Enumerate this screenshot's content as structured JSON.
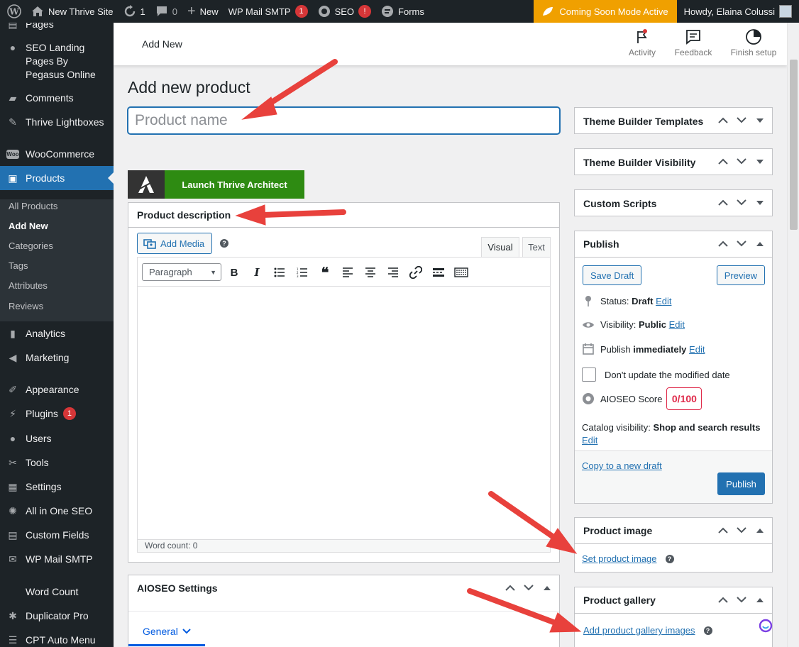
{
  "adminbar": {
    "site_name": "New Thrive Site",
    "updates_count": "1",
    "comments_count": "0",
    "new_label": "New",
    "wpmail_label": "WP Mail SMTP",
    "wpmail_badge": "1",
    "seo_label": "SEO",
    "seo_badge": "!",
    "forms_label": "Forms",
    "coming_soon": "Coming Soon Mode Active",
    "howdy": "Howdy, Elaina Colussi"
  },
  "sidebar": {
    "pages": "Pages",
    "seo_landing": "SEO Landing Pages By Pegasus Online",
    "comments": "Comments",
    "thrive_lightboxes": "Thrive Lightboxes",
    "woocommerce": "WooCommerce",
    "products": "Products",
    "sub": {
      "all_products": "All Products",
      "add_new": "Add New",
      "categories": "Categories",
      "tags": "Tags",
      "attributes": "Attributes",
      "reviews": "Reviews"
    },
    "analytics": "Analytics",
    "marketing": "Marketing",
    "appearance": "Appearance",
    "plugins": "Plugins",
    "plugins_badge": "1",
    "users": "Users",
    "tools": "Tools",
    "settings": "Settings",
    "all_in_one_seo": "All in One SEO",
    "custom_fields": "Custom Fields",
    "wp_mail_smtp": "WP Mail SMTP",
    "word_count": "Word Count",
    "duplicator_pro": "Duplicator Pro",
    "cpt_auto_menu": "CPT Auto Menu"
  },
  "header": {
    "title": "Add New",
    "activity": "Activity",
    "feedback": "Feedback",
    "finish_setup": "Finish setup"
  },
  "main": {
    "page_title": "Add new product",
    "product_name_placeholder": "Product name",
    "launch_thrive": "Launch Thrive Architect",
    "description": {
      "title": "Product description",
      "add_media": "Add Media",
      "tab_visual": "Visual",
      "tab_text": "Text",
      "paragraph": "Paragraph",
      "word_count": "Word count: 0"
    },
    "aioseo": {
      "title": "AIOSEO Settings",
      "tab_general": "General"
    }
  },
  "right": {
    "theme_builder_templates": "Theme Builder Templates",
    "theme_builder_visibility": "Theme Builder Visibility",
    "custom_scripts": "Custom Scripts",
    "publish": {
      "title": "Publish",
      "save_draft": "Save Draft",
      "preview": "Preview",
      "status_label": "Status:",
      "status_value": "Draft",
      "visibility_label": "Visibility:",
      "visibility_value": "Public",
      "publish_label": "Publish",
      "publish_value": "immediately",
      "edit": "Edit",
      "dont_update": "Don't update the modified date",
      "aioseo_score_label": "AIOSEO Score",
      "aioseo_score": "0/100",
      "catalog_label": "Catalog visibility:",
      "catalog_value": "Shop and search results",
      "copy_draft": "Copy to a new draft",
      "publish_button": "Publish"
    },
    "product_image": {
      "title": "Product image",
      "link": "Set product image"
    },
    "product_gallery": {
      "title": "Product gallery",
      "link": "Add product gallery images"
    }
  },
  "colors": {
    "wp_blue": "#2271b1",
    "admin_dark": "#1d2327",
    "thrive_green": "#2e8b12",
    "coming_soon": "#f0a000",
    "badge_red": "#d63638",
    "arrow_red": "#e8413c"
  }
}
